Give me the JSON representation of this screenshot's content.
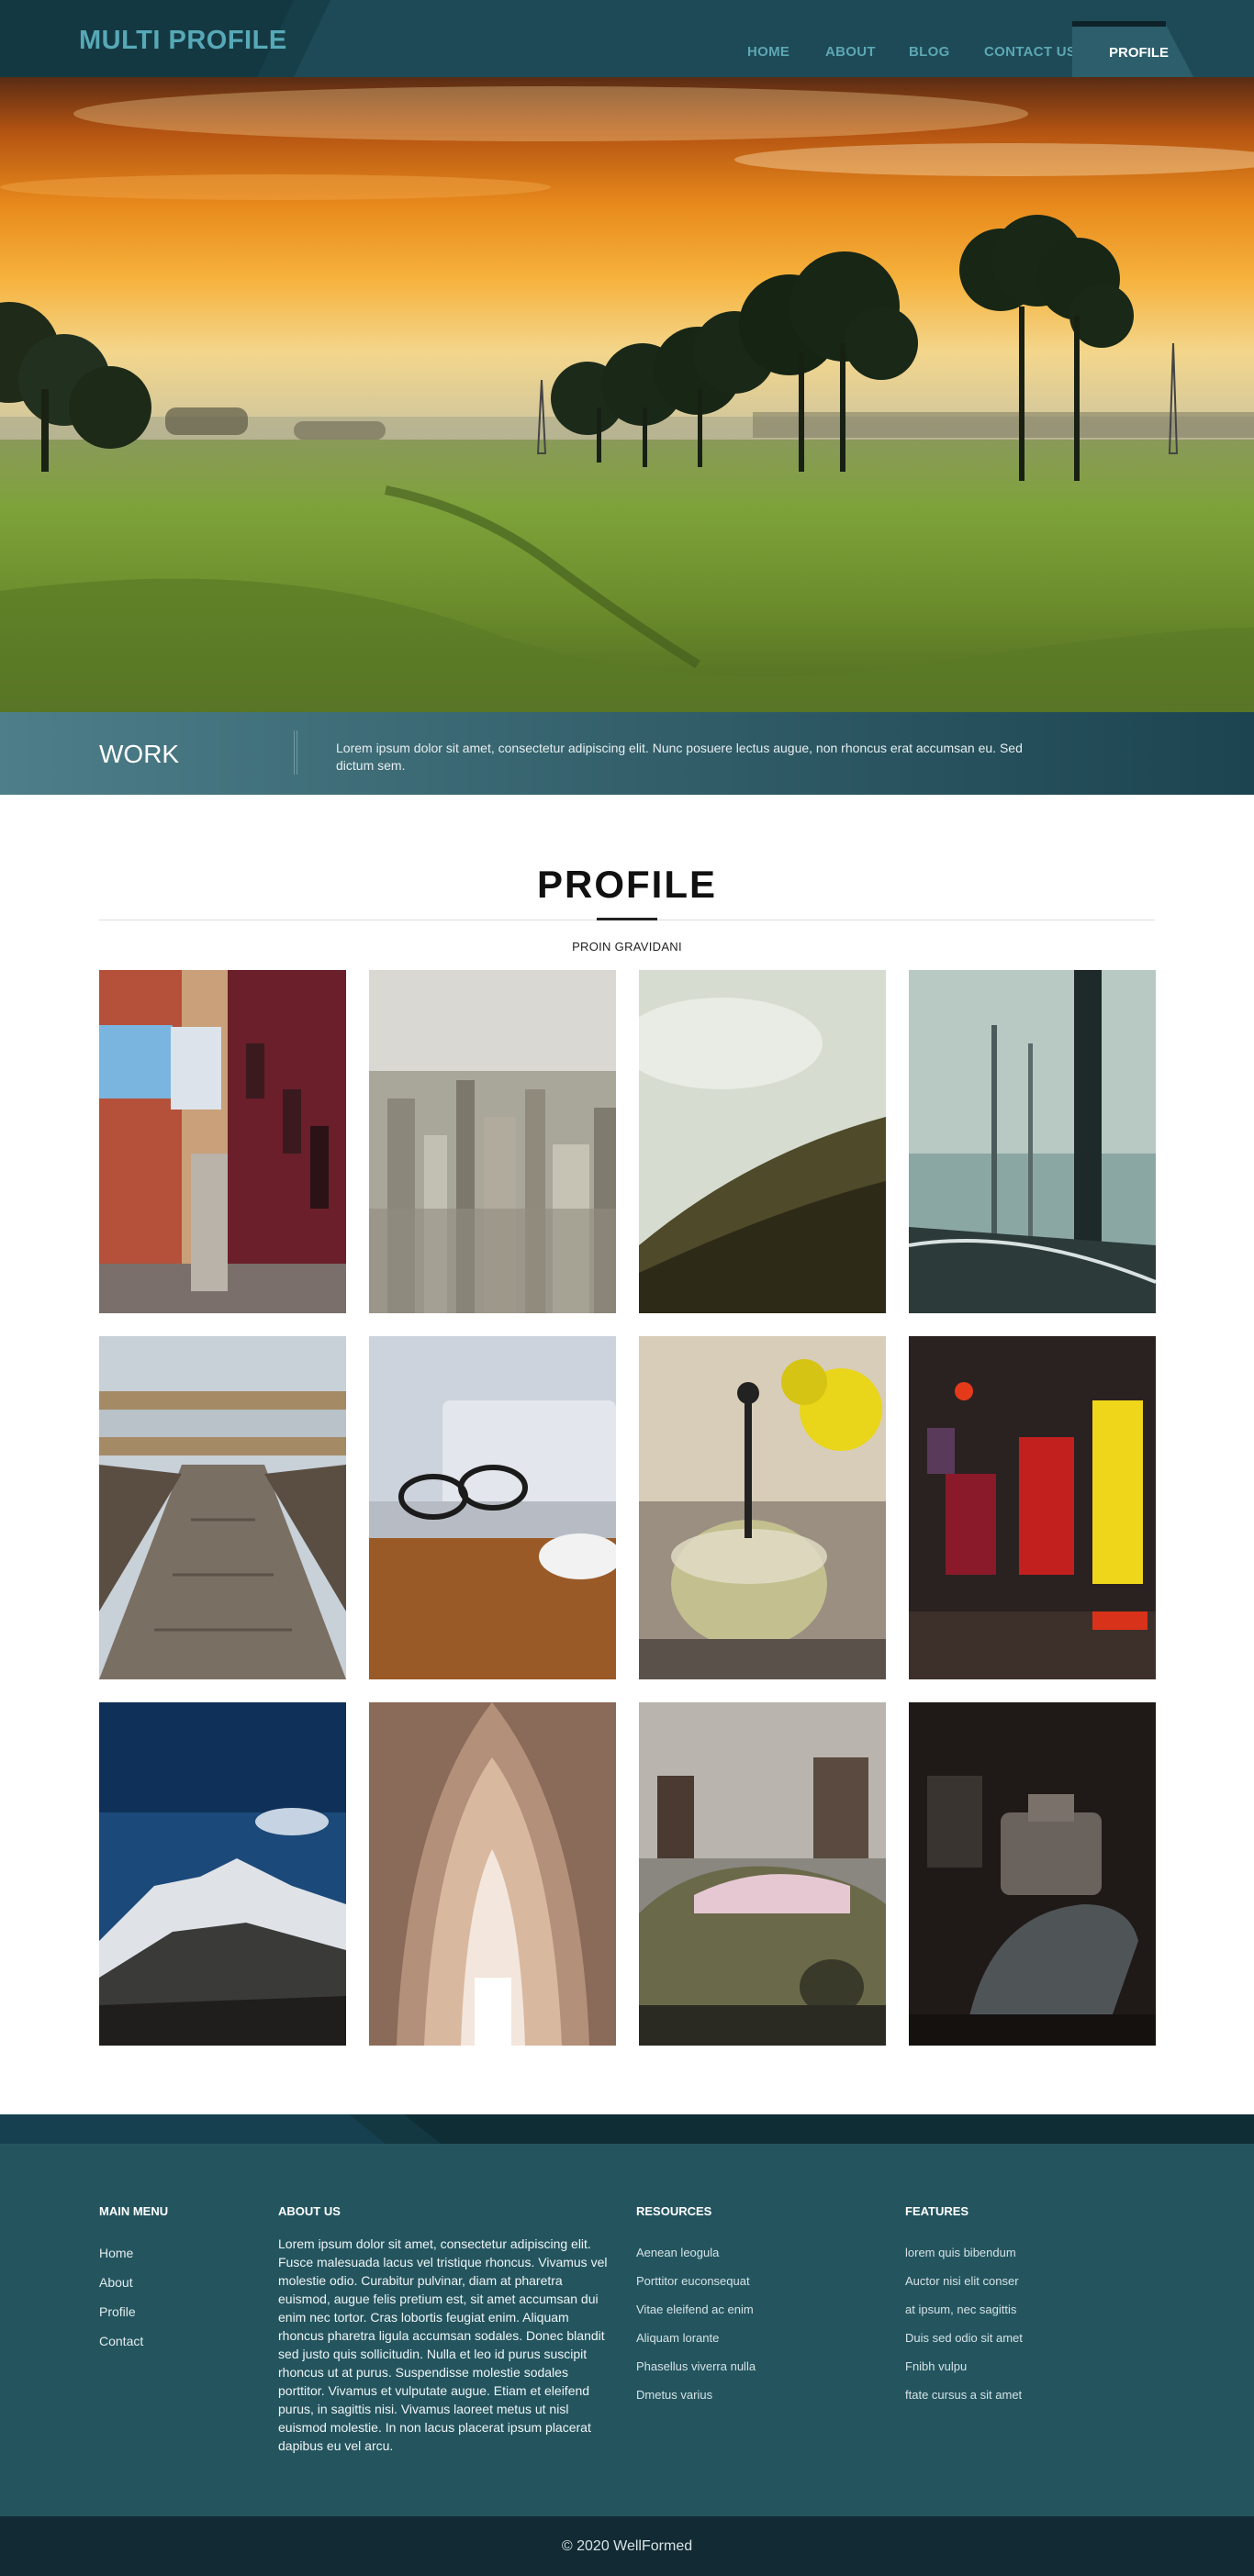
{
  "header": {
    "logo": "MULTI PROFILE",
    "nav": [
      {
        "label": "HOME"
      },
      {
        "label": "ABOUT"
      },
      {
        "label": "BLOG"
      },
      {
        "label": "CONTACT US"
      }
    ],
    "active_nav": "PROFILE"
  },
  "work": {
    "title": "WORK",
    "text": "Lorem ipsum dolor sit amet, consectetur adipiscing elit. Nunc posuere lectus augue, non rhoncus erat accumsan eu. Sed dictum sem."
  },
  "profile": {
    "title": "PROFILE",
    "subtitle": "PROIN GRAVIDANI"
  },
  "gallery": [
    {
      "subject": "red building with laundry"
    },
    {
      "subject": "city skyline"
    },
    {
      "subject": "green hill"
    },
    {
      "subject": "misty forest"
    },
    {
      "subject": "wooden boardwalk"
    },
    {
      "subject": "glasses on laptop"
    },
    {
      "subject": "tea press"
    },
    {
      "subject": "night city signs"
    },
    {
      "subject": "snowy mountain"
    },
    {
      "subject": "cathedral arches"
    },
    {
      "subject": "old car"
    },
    {
      "subject": "vintage projector"
    }
  ],
  "footer": {
    "main_menu": {
      "heading": "MAIN MENU",
      "links": [
        "Home",
        "About",
        "Profile",
        "Contact"
      ]
    },
    "about": {
      "heading": "ABOUT US",
      "text": "Lorem ipsum dolor sit amet, consectetur adipiscing elit. Fusce malesuada lacus vel tristique rhoncus. Vivamus vel molestie odio. Curabitur pulvinar, diam at pharetra euismod, augue felis pretium est, sit amet accumsan dui enim nec tortor. Cras lobortis feugiat enim. Aliquam rhoncus pharetra ligula accumsan sodales. Donec blandit sed justo quis sollicitudin. Nulla et leo id purus suscipit rhoncus ut at purus. Suspendisse molestie sodales porttitor. Vivamus et vulputate augue. Etiam et eleifend purus, in sagittis nisi. Vivamus laoreet metus ut nisl euismod molestie. In non lacus placerat ipsum placerat dapibus eu vel arcu."
    },
    "resources": {
      "heading": "RESOURCES",
      "links": [
        "Aenean leogula",
        "Porttitor euconsequat",
        "Vitae eleifend ac enim",
        "Aliquam lorante",
        "Phasellus viverra nulla",
        "Dmetus varius"
      ]
    },
    "features": {
      "heading": "FEATURES",
      "links": [
        "lorem quis bibendum",
        "Auctor nisi elit conser",
        "at ipsum, nec sagittis",
        "Duis sed odio sit amet",
        "Fnibh vulpu",
        "ftate cursus a sit amet"
      ]
    }
  },
  "copyright": "© 2020 WellFormed",
  "colors": {
    "header_bg": "#1d4a56",
    "logo": "#57a9b7",
    "footer_bg": "#24555f",
    "bottom_bar": "#112a33"
  }
}
